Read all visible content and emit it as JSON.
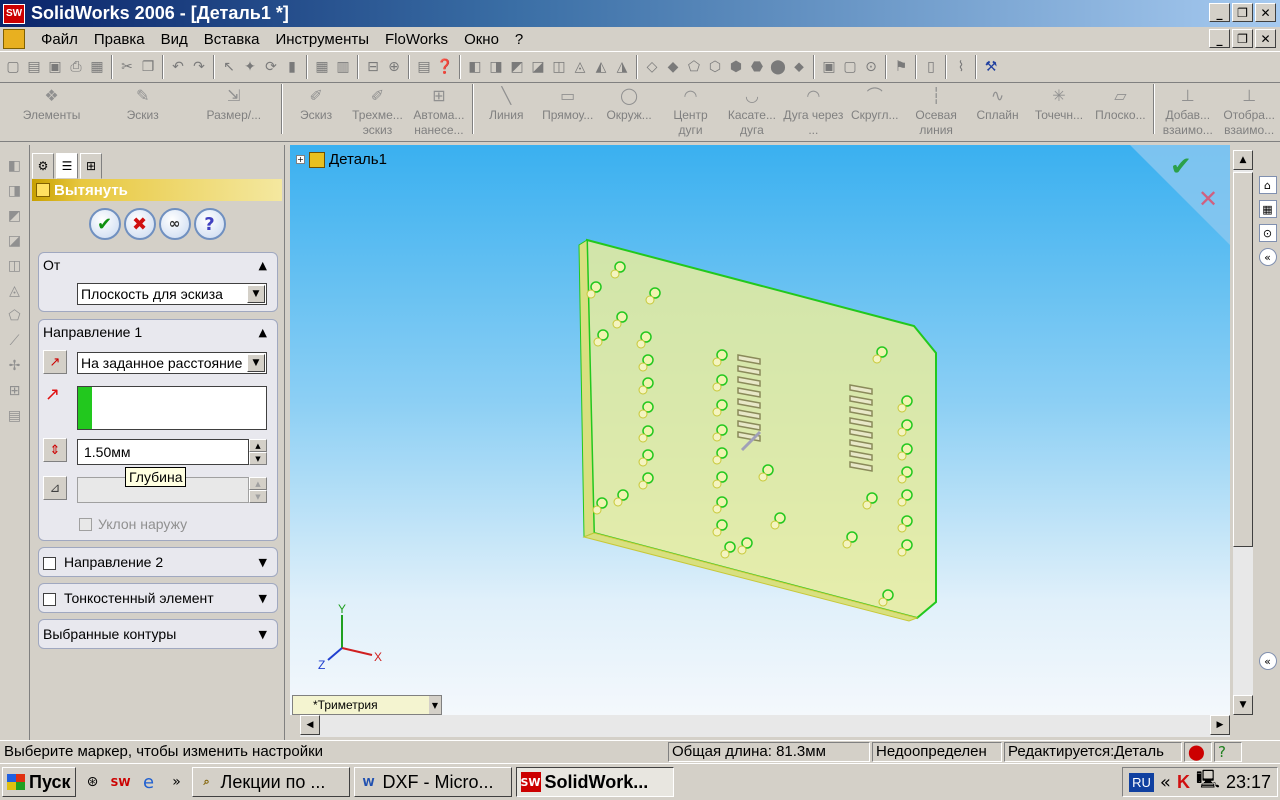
{
  "window": {
    "title": "SolidWorks 2006 - [Деталь1 *]",
    "app_logo": "SW",
    "controls": [
      "_",
      "❐",
      "✕"
    ]
  },
  "menu": {
    "items": [
      "Файл",
      "Правка",
      "Вид",
      "Вставка",
      "Инструменты",
      "FloWorks",
      "Окно",
      "?"
    ]
  },
  "toolbar2": {
    "items": [
      {
        "label": "Элементы",
        "icon": "❖"
      },
      {
        "label": "Эскиз",
        "icon": "✎"
      },
      {
        "label": "Размер/...",
        "icon": "⇲"
      },
      {
        "label": "Эскиз",
        "icon": "✐"
      },
      {
        "label": "Трехме... эскиз",
        "icon": "✐"
      },
      {
        "label": "Автома... нанесе...",
        "icon": "⊞"
      },
      {
        "label": "Линия",
        "icon": "╲"
      },
      {
        "label": "Прямоу...",
        "icon": "▭"
      },
      {
        "label": "Окруж...",
        "icon": "◯"
      },
      {
        "label": "Центр дуги",
        "icon": "◠"
      },
      {
        "label": "Касате... дуга",
        "icon": "◡"
      },
      {
        "label": "Дуга через ...",
        "icon": "◠"
      },
      {
        "label": "Скругл...",
        "icon": "⌒"
      },
      {
        "label": "Осевая линия",
        "icon": "┆"
      },
      {
        "label": "Сплайн",
        "icon": "∿"
      },
      {
        "label": "Точечн...",
        "icon": "✳"
      },
      {
        "label": "Плоско...",
        "icon": "▱"
      },
      {
        "label": "Добав... взаимо...",
        "icon": "⊥"
      },
      {
        "label": "Отобра... взаимо...",
        "icon": "⊥"
      }
    ]
  },
  "panel": {
    "feature_title": "Вытянуть",
    "from": {
      "label": "От",
      "value": "Плоскость для эскиза"
    },
    "direction1": {
      "label": "Направление 1",
      "end_condition": "На заданное расстояние",
      "depth": "1.50мм",
      "tooltip": "Глубина",
      "draft_label": "Уклон наружу"
    },
    "direction2": {
      "label": "Направление 2"
    },
    "thin": {
      "label": "Тонкостенный элемент"
    },
    "contours": {
      "label": "Выбранные контуры"
    }
  },
  "graphics": {
    "tree_root": "Деталь1",
    "view": "*Триметрия",
    "axes": {
      "x": "X",
      "y": "Y",
      "z": "Z"
    }
  },
  "status": {
    "hint": "Выберите маркер, чтобы изменить настройки",
    "length": "Общая длина: 81.3мм",
    "state": "Недоопределен",
    "editing": "Редактируется:Деталь"
  },
  "taskbar": {
    "start": "Пуск",
    "tasks": [
      {
        "label": "Лекции по ...",
        "icon": "🔍"
      },
      {
        "label": "DXF - Micro...",
        "icon": "W"
      },
      {
        "label": "SolidWork...",
        "icon": "SW"
      }
    ],
    "lang": "RU",
    "time": "23:17"
  },
  "colors": {
    "accent_green": "#22c81e",
    "plate_fill": "#e6ec9e",
    "sky_top": "#3ab0f0"
  }
}
